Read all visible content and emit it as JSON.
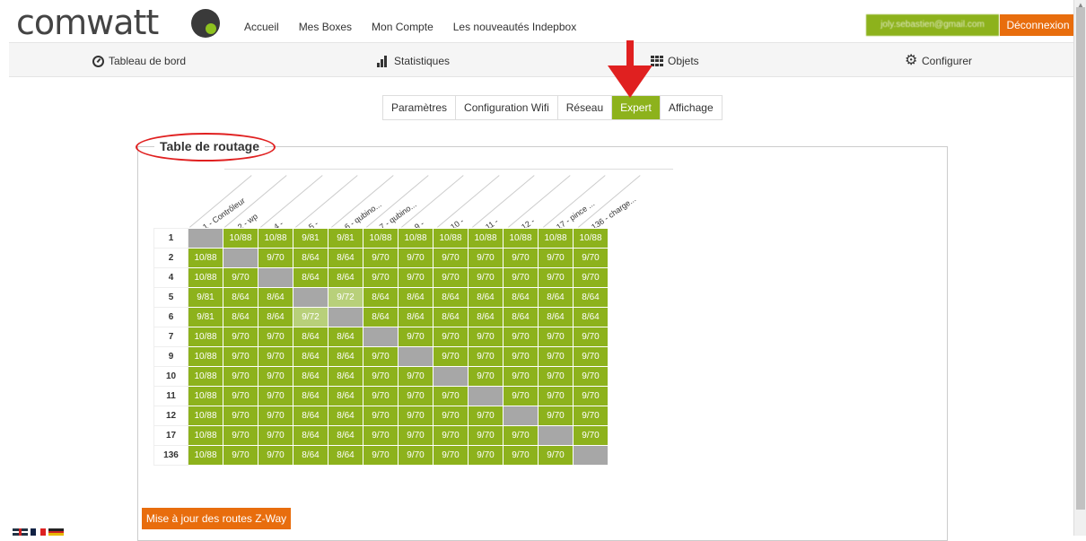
{
  "brand": {
    "name": "comwatt"
  },
  "topnav": [
    "Accueil",
    "Mes Boxes",
    "Mon Compte",
    "Les nouveautés Indepbox"
  ],
  "user": {
    "email": "joly.sebastien@gmail.com",
    "logout": "Déconnexion"
  },
  "mainnav": [
    {
      "label": "Tableau de bord",
      "icon": "dashboard-icon"
    },
    {
      "label": "Statistiques",
      "icon": "bar-chart-icon"
    },
    {
      "label": "Objets",
      "icon": "grid-icon"
    },
    {
      "label": "Configurer",
      "icon": "gear-icon"
    }
  ],
  "tabs": [
    "Paramètres",
    "Configuration Wifi",
    "Réseau",
    "Expert",
    "Affichage"
  ],
  "active_tab": "Expert",
  "routing": {
    "title": "Table de routage",
    "columns": [
      "1 - Contrôleur",
      "2 - wp",
      "4 -",
      "5 -",
      "6 - qubino...",
      "7 - qubino...",
      "9 -",
      "10 -",
      "11 -",
      "12 -",
      "17 - pince ...",
      "136 - charge..."
    ],
    "rows": [
      {
        "id": "1",
        "cells": [
          "",
          "10/88",
          "10/88",
          "9/81",
          "9/81",
          "10/88",
          "10/88",
          "10/88",
          "10/88",
          "10/88",
          "10/88",
          "10/88"
        ]
      },
      {
        "id": "2",
        "cells": [
          "10/88",
          "",
          "9/70",
          "8/64",
          "8/64",
          "9/70",
          "9/70",
          "9/70",
          "9/70",
          "9/70",
          "9/70",
          "9/70"
        ]
      },
      {
        "id": "4",
        "cells": [
          "10/88",
          "9/70",
          "",
          "8/64",
          "8/64",
          "9/70",
          "9/70",
          "9/70",
          "9/70",
          "9/70",
          "9/70",
          "9/70"
        ]
      },
      {
        "id": "5",
        "cells": [
          "9/81",
          "8/64",
          "8/64",
          "",
          "9/72",
          "8/64",
          "8/64",
          "8/64",
          "8/64",
          "8/64",
          "8/64",
          "8/64"
        ]
      },
      {
        "id": "6",
        "cells": [
          "9/81",
          "8/64",
          "8/64",
          "9/72",
          "",
          "8/64",
          "8/64",
          "8/64",
          "8/64",
          "8/64",
          "8/64",
          "8/64"
        ]
      },
      {
        "id": "7",
        "cells": [
          "10/88",
          "9/70",
          "9/70",
          "8/64",
          "8/64",
          "",
          "9/70",
          "9/70",
          "9/70",
          "9/70",
          "9/70",
          "9/70"
        ]
      },
      {
        "id": "9",
        "cells": [
          "10/88",
          "9/70",
          "9/70",
          "8/64",
          "8/64",
          "9/70",
          "",
          "9/70",
          "9/70",
          "9/70",
          "9/70",
          "9/70"
        ]
      },
      {
        "id": "10",
        "cells": [
          "10/88",
          "9/70",
          "9/70",
          "8/64",
          "8/64",
          "9/70",
          "9/70",
          "",
          "9/70",
          "9/70",
          "9/70",
          "9/70"
        ]
      },
      {
        "id": "11",
        "cells": [
          "10/88",
          "9/70",
          "9/70",
          "8/64",
          "8/64",
          "9/70",
          "9/70",
          "9/70",
          "",
          "9/70",
          "9/70",
          "9/70"
        ]
      },
      {
        "id": "12",
        "cells": [
          "10/88",
          "9/70",
          "9/70",
          "8/64",
          "8/64",
          "9/70",
          "9/70",
          "9/70",
          "9/70",
          "",
          "9/70",
          "9/70"
        ]
      },
      {
        "id": "17",
        "cells": [
          "10/88",
          "9/70",
          "9/70",
          "8/64",
          "8/64",
          "9/70",
          "9/70",
          "9/70",
          "9/70",
          "9/70",
          "",
          "9/70"
        ]
      },
      {
        "id": "136",
        "cells": [
          "10/88",
          "9/70",
          "9/70",
          "8/64",
          "8/64",
          "9/70",
          "9/70",
          "9/70",
          "9/70",
          "9/70",
          "9/70",
          ""
        ]
      }
    ]
  },
  "update_button": "Mise à jour des routes Z-Way",
  "colors": {
    "green": "#8db21c",
    "light_green": "#b8d07a",
    "gray": "#a7a7a7",
    "orange": "#e86d0d",
    "annotation_red": "#e02020"
  }
}
